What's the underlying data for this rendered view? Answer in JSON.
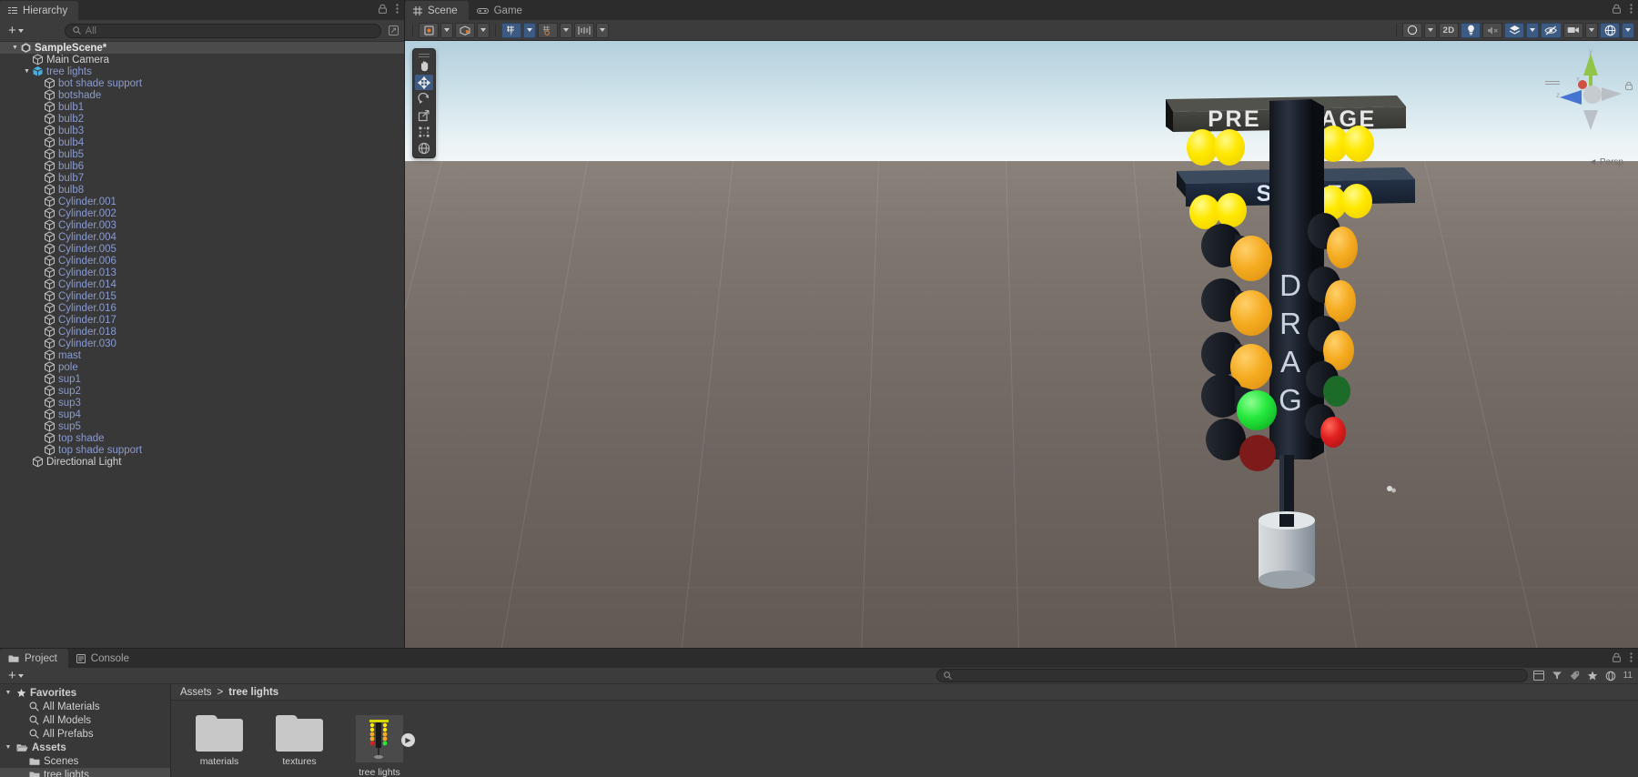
{
  "hierarchy": {
    "tab_label": "Hierarchy",
    "search_placeholder": "All",
    "add_label": "+",
    "items": [
      {
        "label": "SampleScene*",
        "depth": 0,
        "icon": "unity-scene-icon",
        "kind": "scene",
        "expanded": true,
        "selected": true
      },
      {
        "label": "Main Camera",
        "depth": 1,
        "icon": "gameobject-icon",
        "kind": "object",
        "expanded": false,
        "selected": false
      },
      {
        "label": "tree lights",
        "depth": 1,
        "icon": "prefab-icon",
        "kind": "prefab-root",
        "expanded": true,
        "selected": false
      },
      {
        "label": "bot shade support",
        "depth": 2,
        "icon": "gameobject-icon",
        "kind": "prefab",
        "expanded": false,
        "selected": false
      },
      {
        "label": "botshade",
        "depth": 2,
        "icon": "gameobject-icon",
        "kind": "prefab",
        "expanded": false,
        "selected": false
      },
      {
        "label": "bulb1",
        "depth": 2,
        "icon": "gameobject-icon",
        "kind": "prefab",
        "expanded": false,
        "selected": false
      },
      {
        "label": "bulb2",
        "depth": 2,
        "icon": "gameobject-icon",
        "kind": "prefab",
        "expanded": false,
        "selected": false
      },
      {
        "label": "bulb3",
        "depth": 2,
        "icon": "gameobject-icon",
        "kind": "prefab",
        "expanded": false,
        "selected": false
      },
      {
        "label": "bulb4",
        "depth": 2,
        "icon": "gameobject-icon",
        "kind": "prefab",
        "expanded": false,
        "selected": false
      },
      {
        "label": "bulb5",
        "depth": 2,
        "icon": "gameobject-icon",
        "kind": "prefab",
        "expanded": false,
        "selected": false
      },
      {
        "label": "bulb6",
        "depth": 2,
        "icon": "gameobject-icon",
        "kind": "prefab",
        "expanded": false,
        "selected": false
      },
      {
        "label": "bulb7",
        "depth": 2,
        "icon": "gameobject-icon",
        "kind": "prefab",
        "expanded": false,
        "selected": false
      },
      {
        "label": "bulb8",
        "depth": 2,
        "icon": "gameobject-icon",
        "kind": "prefab",
        "expanded": false,
        "selected": false
      },
      {
        "label": "Cylinder.001",
        "depth": 2,
        "icon": "gameobject-icon",
        "kind": "prefab",
        "expanded": false,
        "selected": false
      },
      {
        "label": "Cylinder.002",
        "depth": 2,
        "icon": "gameobject-icon",
        "kind": "prefab",
        "expanded": false,
        "selected": false
      },
      {
        "label": "Cylinder.003",
        "depth": 2,
        "icon": "gameobject-icon",
        "kind": "prefab",
        "expanded": false,
        "selected": false
      },
      {
        "label": "Cylinder.004",
        "depth": 2,
        "icon": "gameobject-icon",
        "kind": "prefab",
        "expanded": false,
        "selected": false
      },
      {
        "label": "Cylinder.005",
        "depth": 2,
        "icon": "gameobject-icon",
        "kind": "prefab",
        "expanded": false,
        "selected": false
      },
      {
        "label": "Cylinder.006",
        "depth": 2,
        "icon": "gameobject-icon",
        "kind": "prefab",
        "expanded": false,
        "selected": false
      },
      {
        "label": "Cylinder.013",
        "depth": 2,
        "icon": "gameobject-icon",
        "kind": "prefab",
        "expanded": false,
        "selected": false
      },
      {
        "label": "Cylinder.014",
        "depth": 2,
        "icon": "gameobject-icon",
        "kind": "prefab",
        "expanded": false,
        "selected": false
      },
      {
        "label": "Cylinder.015",
        "depth": 2,
        "icon": "gameobject-icon",
        "kind": "prefab",
        "expanded": false,
        "selected": false
      },
      {
        "label": "Cylinder.016",
        "depth": 2,
        "icon": "gameobject-icon",
        "kind": "prefab",
        "expanded": false,
        "selected": false
      },
      {
        "label": "Cylinder.017",
        "depth": 2,
        "icon": "gameobject-icon",
        "kind": "prefab",
        "expanded": false,
        "selected": false
      },
      {
        "label": "Cylinder.018",
        "depth": 2,
        "icon": "gameobject-icon",
        "kind": "prefab",
        "expanded": false,
        "selected": false
      },
      {
        "label": "Cylinder.030",
        "depth": 2,
        "icon": "gameobject-icon",
        "kind": "prefab",
        "expanded": false,
        "selected": false
      },
      {
        "label": "mast",
        "depth": 2,
        "icon": "gameobject-icon",
        "kind": "prefab",
        "expanded": false,
        "selected": false
      },
      {
        "label": "pole",
        "depth": 2,
        "icon": "gameobject-icon",
        "kind": "prefab",
        "expanded": false,
        "selected": false
      },
      {
        "label": "sup1",
        "depth": 2,
        "icon": "gameobject-icon",
        "kind": "prefab",
        "expanded": false,
        "selected": false
      },
      {
        "label": "sup2",
        "depth": 2,
        "icon": "gameobject-icon",
        "kind": "prefab",
        "expanded": false,
        "selected": false
      },
      {
        "label": "sup3",
        "depth": 2,
        "icon": "gameobject-icon",
        "kind": "prefab",
        "expanded": false,
        "selected": false
      },
      {
        "label": "sup4",
        "depth": 2,
        "icon": "gameobject-icon",
        "kind": "prefab",
        "expanded": false,
        "selected": false
      },
      {
        "label": "sup5",
        "depth": 2,
        "icon": "gameobject-icon",
        "kind": "prefab",
        "expanded": false,
        "selected": false
      },
      {
        "label": "top shade",
        "depth": 2,
        "icon": "gameobject-icon",
        "kind": "prefab",
        "expanded": false,
        "selected": false
      },
      {
        "label": "top shade support",
        "depth": 2,
        "icon": "gameobject-icon",
        "kind": "prefab",
        "expanded": false,
        "selected": false
      },
      {
        "label": "Directional Light",
        "depth": 1,
        "icon": "gameobject-icon",
        "kind": "object",
        "expanded": false,
        "selected": false
      }
    ]
  },
  "scene_view": {
    "tabs": [
      {
        "label": "Scene",
        "icon": "scene-grid-icon",
        "active": true
      },
      {
        "label": "Game",
        "icon": "gamepad-icon",
        "active": false
      }
    ],
    "toolbar": {
      "draw_mode_label": "Shaded",
      "pivot_label": "Center",
      "grid_label": "Grid",
      "snap_label": "Snap",
      "layout_label": "Layers",
      "twod_label": "2D",
      "lighting_on": true,
      "audio_on": false,
      "effects_on": true,
      "hidden_objects_on": true,
      "camera_label": "Camera",
      "gizmos_label": "Gizmos"
    },
    "tools": [
      {
        "name": "hand-tool",
        "active": false
      },
      {
        "name": "move-tool",
        "active": true
      },
      {
        "name": "rotate-tool",
        "active": false
      },
      {
        "name": "scale-tool",
        "active": false
      },
      {
        "name": "rect-tool",
        "active": false
      },
      {
        "name": "transform-tool",
        "active": false
      }
    ],
    "gizmo": {
      "projection_label": "Persp",
      "axis_x": "x",
      "axis_y": "y",
      "axis_z": "z",
      "color_x": "#d04a3c",
      "color_y": "#8fc442",
      "color_z": "#3f6fd0"
    },
    "content": {
      "sign_top_text": "PRE - STAGE",
      "sign_mid_text": "STAGE",
      "mast_letters": [
        "D",
        "R",
        "A",
        "G"
      ],
      "bulb_color": "#ffe800",
      "amber_color": "#f5ab20",
      "green_color": "#25e83c",
      "red_color": "#e02020",
      "dark_green_color": "#1d6b28",
      "dark_red_color": "#7d1b1b",
      "sign_top_color": "#3a3a38",
      "sign_mid_color": "#1a2535"
    }
  },
  "project": {
    "tabs": [
      {
        "label": "Project",
        "icon": "folder-icon",
        "active": true
      },
      {
        "label": "Console",
        "icon": "console-icon",
        "active": false
      }
    ],
    "add_label": "+",
    "search_placeholder": "",
    "badge_count": "11",
    "breadcrumb": [
      "Assets",
      "tree lights"
    ],
    "breadcrumb_separator": ">",
    "tree": [
      {
        "label": "Favorites",
        "depth": 0,
        "icon": "star-icon",
        "expanded": true,
        "selected": false
      },
      {
        "label": "All Materials",
        "depth": 1,
        "icon": "search-icon",
        "expanded": false,
        "selected": false
      },
      {
        "label": "All Models",
        "depth": 1,
        "icon": "search-icon",
        "expanded": false,
        "selected": false
      },
      {
        "label": "All Prefabs",
        "depth": 1,
        "icon": "search-icon",
        "expanded": false,
        "selected": false
      },
      {
        "label": "Assets",
        "depth": 0,
        "icon": "folder-open-icon",
        "expanded": true,
        "selected": false
      },
      {
        "label": "Scenes",
        "depth": 1,
        "icon": "folder-icon",
        "expanded": false,
        "selected": false
      },
      {
        "label": "tree lights",
        "depth": 1,
        "icon": "folder-icon",
        "expanded": false,
        "selected": true
      }
    ],
    "assets": [
      {
        "label": "materials",
        "type": "folder"
      },
      {
        "label": "textures",
        "type": "folder"
      },
      {
        "label": "tree lights",
        "type": "prefab-thumbnail",
        "has_play_badge": true
      }
    ]
  }
}
